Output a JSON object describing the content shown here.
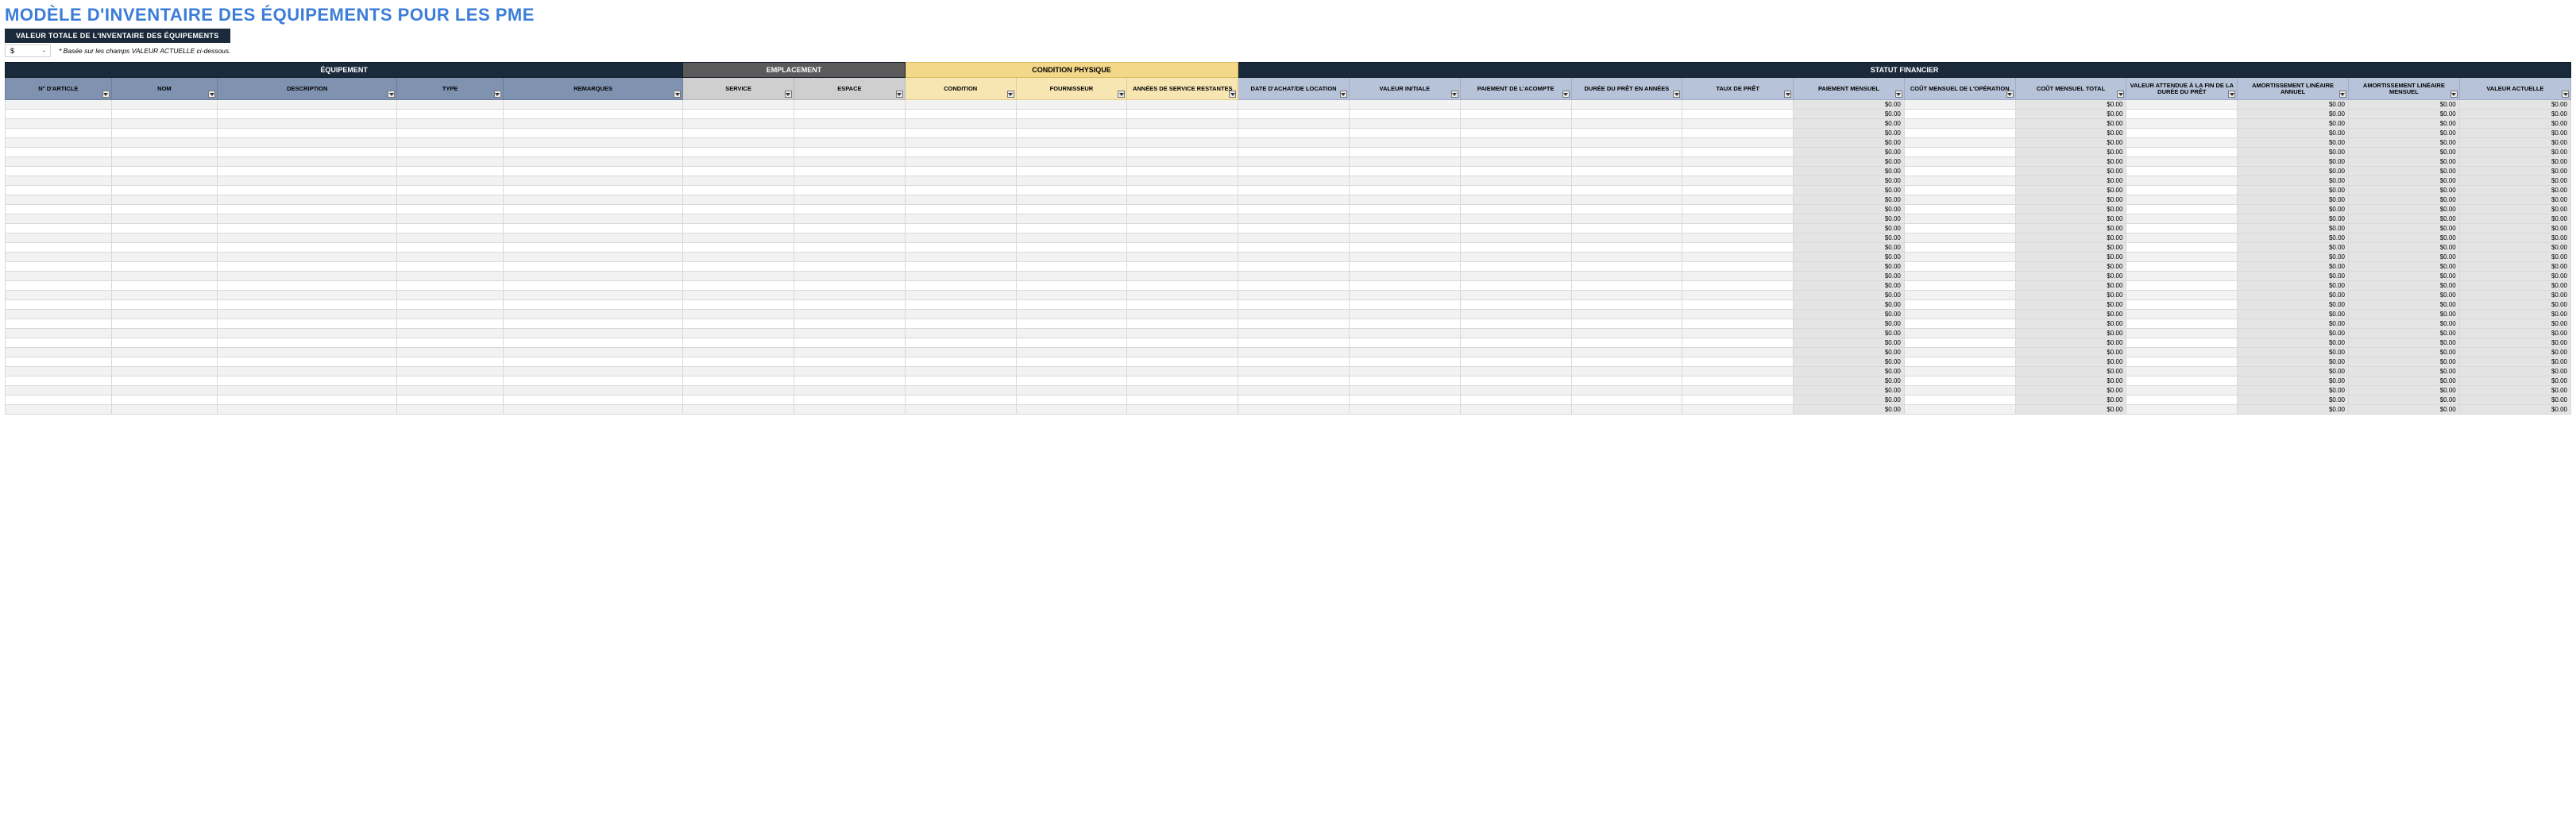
{
  "title": "MODÈLE D'INVENTAIRE DES ÉQUIPEMENTS POUR LES PME",
  "total_box": "VALEUR TOTALE DE L'INVENTAIRE DES ÉQUIPEMENTS",
  "total_currency_symbol": "$",
  "total_currency_value": "-",
  "total_note": "* Basée sur les champs VALEUR ACTUELLE ci-dessous.",
  "sections": {
    "equipment": "ÉQUIPEMENT",
    "location": "EMPLACEMENT",
    "condition": "CONDITION PHYSIQUE",
    "financial": "STATUT FINANCIER"
  },
  "columns": {
    "item_no": "N° D'ARTICLE",
    "name": "NOM",
    "description": "DESCRIPTION",
    "type": "TYPE",
    "remarks": "REMARQUES",
    "department": "SERVICE",
    "space": "ESPACE",
    "condition": "CONDITION",
    "supplier": "FOURNISSEUR",
    "years_remaining": "ANNÉES DE SERVICE RESTANTES",
    "purchase_date": "DATE D'ACHAT/DE LOCATION",
    "initial_value": "VALEUR INITIALE",
    "down_payment": "PAIEMENT DE L'ACOMPTE",
    "loan_years": "DURÉE DU PRÊT EN ANNÉES",
    "loan_rate": "TAUX DE PRÊT",
    "monthly_payment": "PAIEMENT MENSUEL",
    "monthly_op_cost": "COÛT MENSUEL DE L'OPÉRATION",
    "monthly_total_cost": "COÛT MENSUEL TOTAL",
    "expected_end_value": "VALEUR ATTENDUE À LA FIN DE LA DURÉE DU PRÊT",
    "annual_depr": "AMORTISSEMENT LINÉAIRE ANNUEL",
    "monthly_depr": "AMORTISSEMENT LINÉAIRE MENSUEL",
    "current_value": "VALEUR ACTUELLE"
  },
  "zero": "$0.00",
  "row_count": 33,
  "money_column_indexes": [
    15,
    17,
    19,
    20,
    21
  ]
}
